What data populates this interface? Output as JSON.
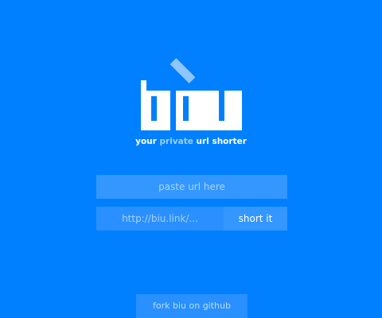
{
  "brand": {
    "logo_text": "biu",
    "tagline_prefix": "your",
    "tagline_accent": "private",
    "tagline_suffix": "url shorter"
  },
  "form": {
    "url_placeholder": "paste url here",
    "result_placeholder": "http://biu.link/...",
    "submit_label": "short it"
  },
  "footer": {
    "fork_label": "fork biu on github"
  },
  "colors": {
    "background": "#007fff",
    "field": "#3397ff",
    "field_dark": "#2a90ff",
    "accent_text": "#9fcfff",
    "logo": "#ffffff",
    "logo_tilde": "#8fc6ff"
  }
}
